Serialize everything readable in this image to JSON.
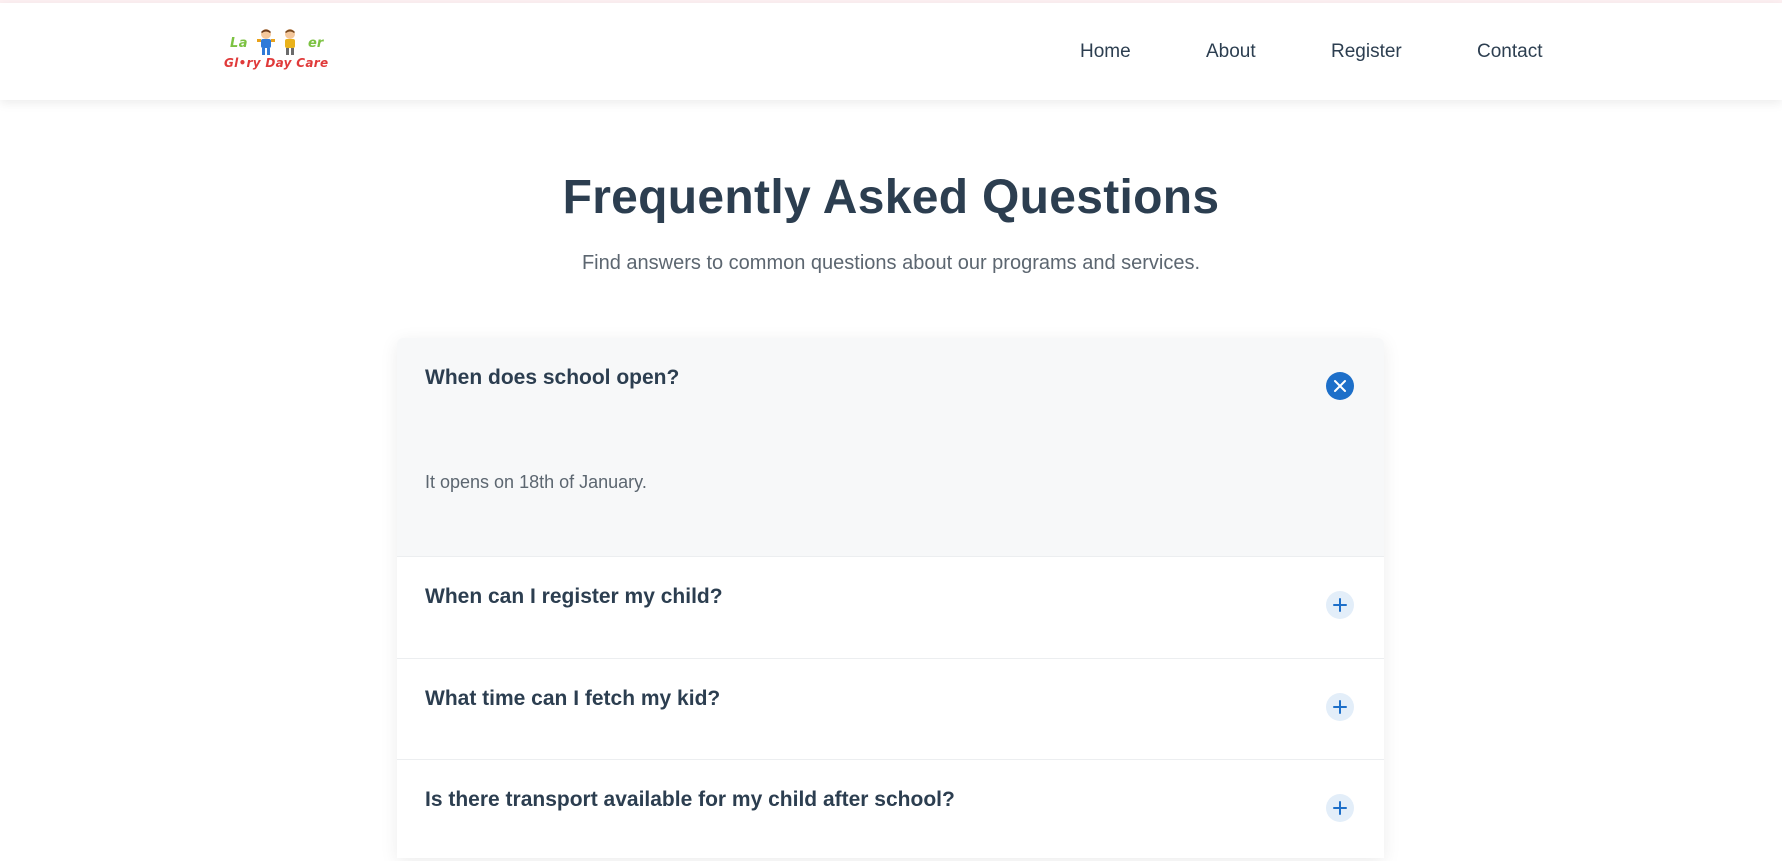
{
  "logo": {
    "line1_left": "La",
    "line1_right": "er",
    "line2": "Gl•ry Day Care"
  },
  "nav": {
    "items": [
      {
        "label": "Home"
      },
      {
        "label": "About"
      },
      {
        "label": "Register"
      },
      {
        "label": "Contact"
      }
    ]
  },
  "hero": {
    "title": "Frequently Asked Questions",
    "subtitle": "Find answers to common questions about our programs and services."
  },
  "faq": {
    "items": [
      {
        "question": "When does school open?",
        "answer": "It opens on 18th of January.",
        "expanded": true,
        "toggle_icon": "close-icon"
      },
      {
        "question": "When can I register my child?",
        "expanded": false,
        "toggle_icon": "plus-icon"
      },
      {
        "question": "What time can I fetch my kid?",
        "expanded": false,
        "toggle_icon": "plus-icon"
      },
      {
        "question": "Is there transport available for my child after school?",
        "expanded": false,
        "toggle_icon": "plus-icon"
      }
    ]
  },
  "colors": {
    "accent": "#1d6fc9",
    "heading": "#2c3e50",
    "muted_text": "#5c6670",
    "open_item_bg": "#f7f8f9"
  }
}
